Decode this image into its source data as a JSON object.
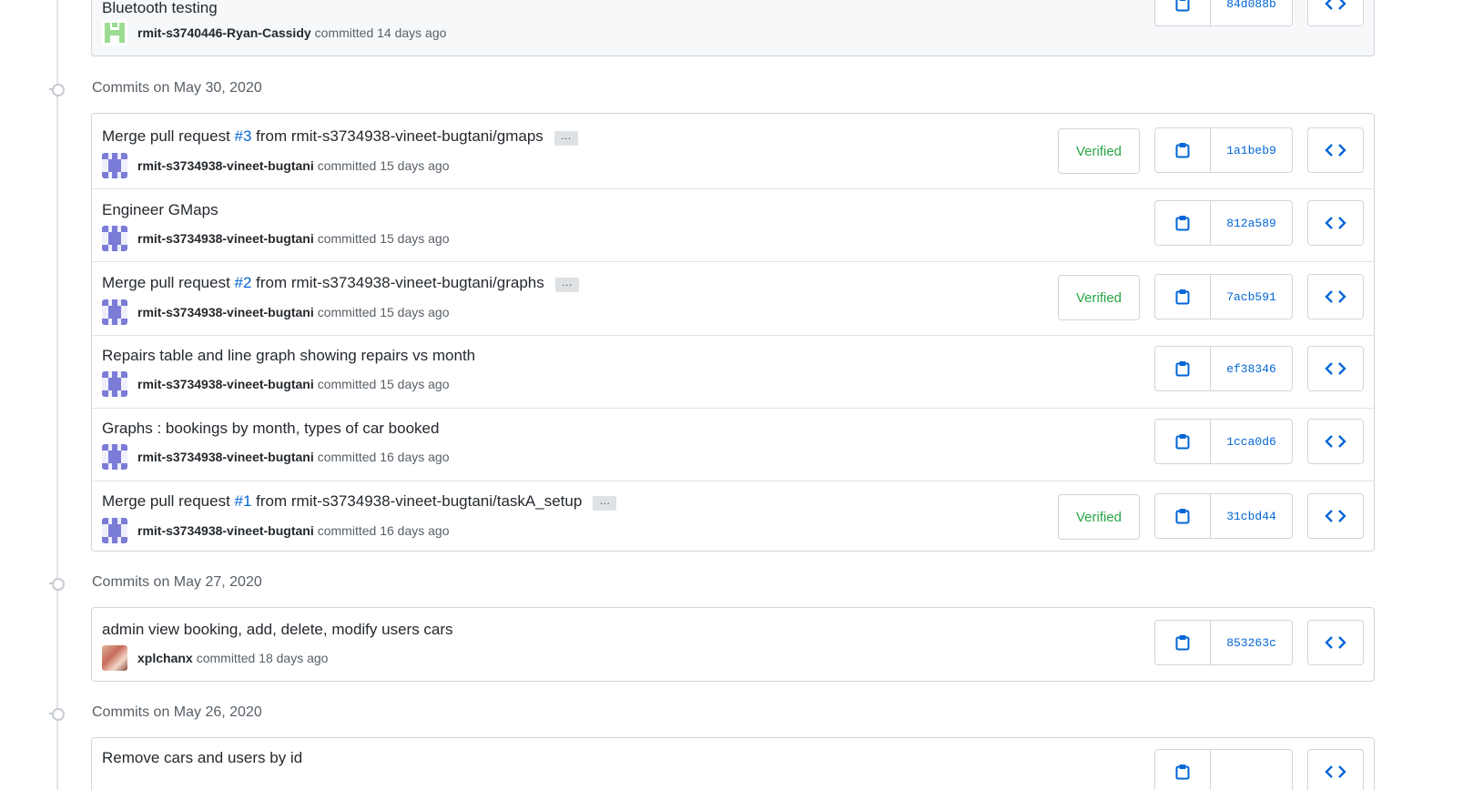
{
  "groups": [
    {
      "date": "",
      "commits": [
        {
          "message": "Bluetooth testing",
          "pr": "",
          "pr_suffix": "",
          "author": "rmit-s3740446-Ryan-Cassidy",
          "action": "committed",
          "time": "14 days ago",
          "verified": false,
          "sha": "84d088b",
          "avatar": "green"
        }
      ]
    },
    {
      "date": "Commits on May 30, 2020",
      "commits": [
        {
          "message": "Merge pull request ",
          "pr": "#3",
          "pr_suffix": " from rmit-s3734938-vineet-bugtani/gmaps",
          "author": "rmit-s3734938-vineet-bugtani",
          "action": "committed",
          "time": "15 days ago",
          "verified": true,
          "sha": "1a1beb9",
          "avatar": "purple"
        },
        {
          "message": "Engineer GMaps",
          "pr": "",
          "pr_suffix": "",
          "author": "rmit-s3734938-vineet-bugtani",
          "action": "committed",
          "time": "15 days ago",
          "verified": false,
          "sha": "812a589",
          "avatar": "purple"
        },
        {
          "message": "Merge pull request ",
          "pr": "#2",
          "pr_suffix": " from rmit-s3734938-vineet-bugtani/graphs",
          "author": "rmit-s3734938-vineet-bugtani",
          "action": "committed",
          "time": "15 days ago",
          "verified": true,
          "sha": "7acb591",
          "avatar": "purple"
        },
        {
          "message": "Repairs table and line graph showing repairs vs month",
          "pr": "",
          "pr_suffix": "",
          "author": "rmit-s3734938-vineet-bugtani",
          "action": "committed",
          "time": "15 days ago",
          "verified": false,
          "sha": "ef38346",
          "avatar": "purple"
        },
        {
          "message": "Graphs : bookings by month, types of car booked",
          "pr": "",
          "pr_suffix": "",
          "author": "rmit-s3734938-vineet-bugtani",
          "action": "committed",
          "time": "16 days ago",
          "verified": false,
          "sha": "1cca0d6",
          "avatar": "purple"
        },
        {
          "message": "Merge pull request ",
          "pr": "#1",
          "pr_suffix": " from rmit-s3734938-vineet-bugtani/taskA_setup",
          "author": "rmit-s3734938-vineet-bugtani",
          "action": "committed",
          "time": "16 days ago",
          "verified": true,
          "sha": "31cbd44",
          "avatar": "purple"
        }
      ]
    },
    {
      "date": "Commits on May 27, 2020",
      "commits": [
        {
          "message": "admin view booking, add, delete, modify users cars",
          "pr": "",
          "pr_suffix": "",
          "author": "xplchanx",
          "action": "committed",
          "time": "18 days ago",
          "verified": false,
          "sha": "853263c",
          "avatar": "photo"
        }
      ]
    },
    {
      "date": "Commits on May 26, 2020",
      "commits": [
        {
          "message": "Remove cars and users by id",
          "pr": "",
          "pr_suffix": "",
          "author": "",
          "action": "",
          "time": "",
          "verified": false,
          "sha": "",
          "avatar": "none"
        }
      ]
    }
  ],
  "labels": {
    "verified": "Verified",
    "ellipsis": "…"
  },
  "icons": {
    "copy": "clippy-icon",
    "browse": "code-icon"
  },
  "colors": {
    "link": "#0366d6",
    "verified": "#28a745",
    "border": "#d1d5da",
    "muted": "#586069"
  }
}
